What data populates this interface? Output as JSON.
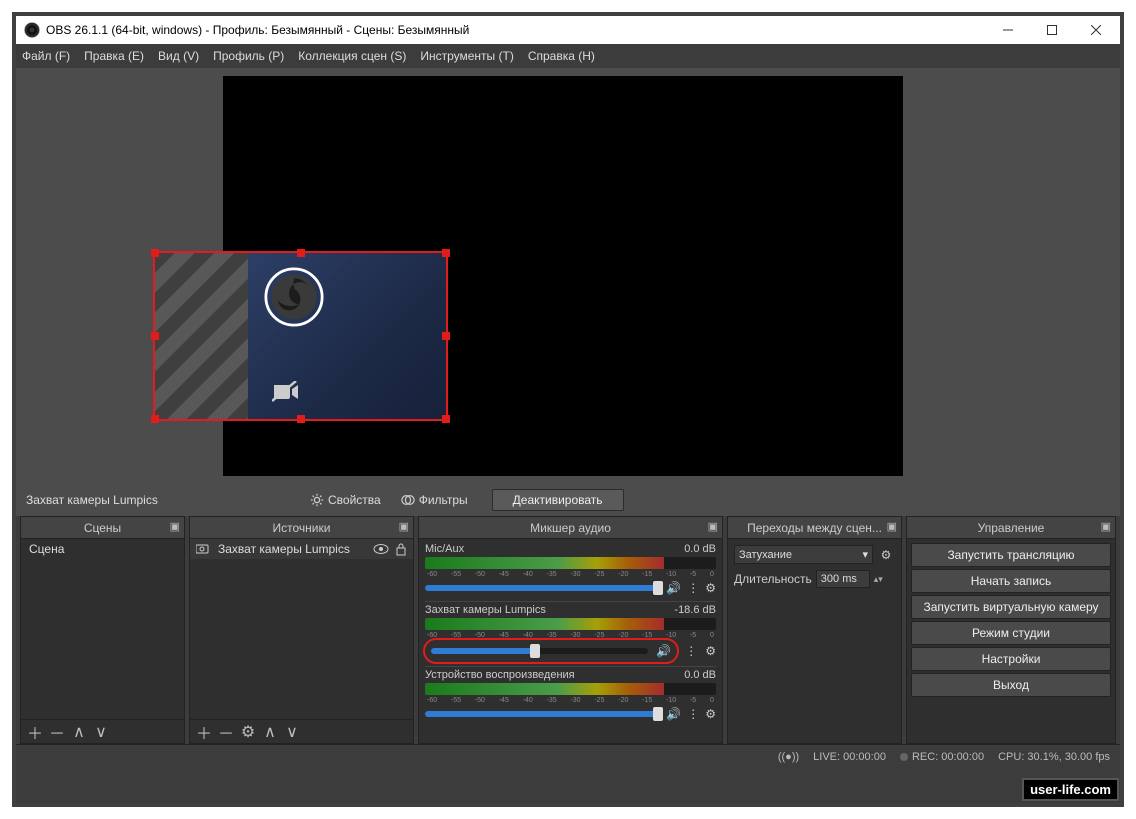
{
  "titlebar": "OBS 26.1.1 (64-bit, windows) - Профиль: Безымянный - Сцены: Безымянный",
  "menu": [
    "Файл (F)",
    "Правка (E)",
    "Вид (V)",
    "Профиль (P)",
    "Коллекция сцен (S)",
    "Инструменты (T)",
    "Справка (H)"
  ],
  "source_bar": {
    "name": "Захват камеры Lumpics",
    "properties": "Свойства",
    "filters": "Фильтры",
    "deactivate": "Деактивировать"
  },
  "docks": {
    "scenes": {
      "title": "Сцены",
      "items": [
        "Сцена"
      ]
    },
    "sources": {
      "title": "Источники",
      "items": [
        "Захват камеры Lumpics"
      ]
    },
    "mixer": {
      "title": "Микшер аудио",
      "ticks": [
        "-60",
        "-55",
        "-50",
        "-45",
        "-40",
        "-35",
        "-30",
        "-25",
        "-20",
        "-15",
        "-10",
        "-5",
        "0"
      ],
      "channels": [
        {
          "name": "Mic/Aux",
          "db": "0.0 dB",
          "fill": 100
        },
        {
          "name": "Захват камеры Lumpics",
          "db": "-18.6 dB",
          "fill": 48,
          "highlight": true
        },
        {
          "name": "Устройство воспроизведения",
          "db": "0.0 dB",
          "fill": 100
        }
      ]
    },
    "transitions": {
      "title": "Переходы между сцен...",
      "mode": "Затухание",
      "dur_label": "Длительность",
      "dur": "300 ms"
    },
    "controls": {
      "title": "Управление",
      "buttons": [
        "Запустить трансляцию",
        "Начать запись",
        "Запустить виртуальную камеру",
        "Режим студии",
        "Настройки",
        "Выход"
      ]
    }
  },
  "status": {
    "live": "LIVE: 00:00:00",
    "rec": "REC: 00:00:00",
    "cpu": "CPU: 30.1%, 30.00 fps"
  },
  "watermark": "user-life.com"
}
